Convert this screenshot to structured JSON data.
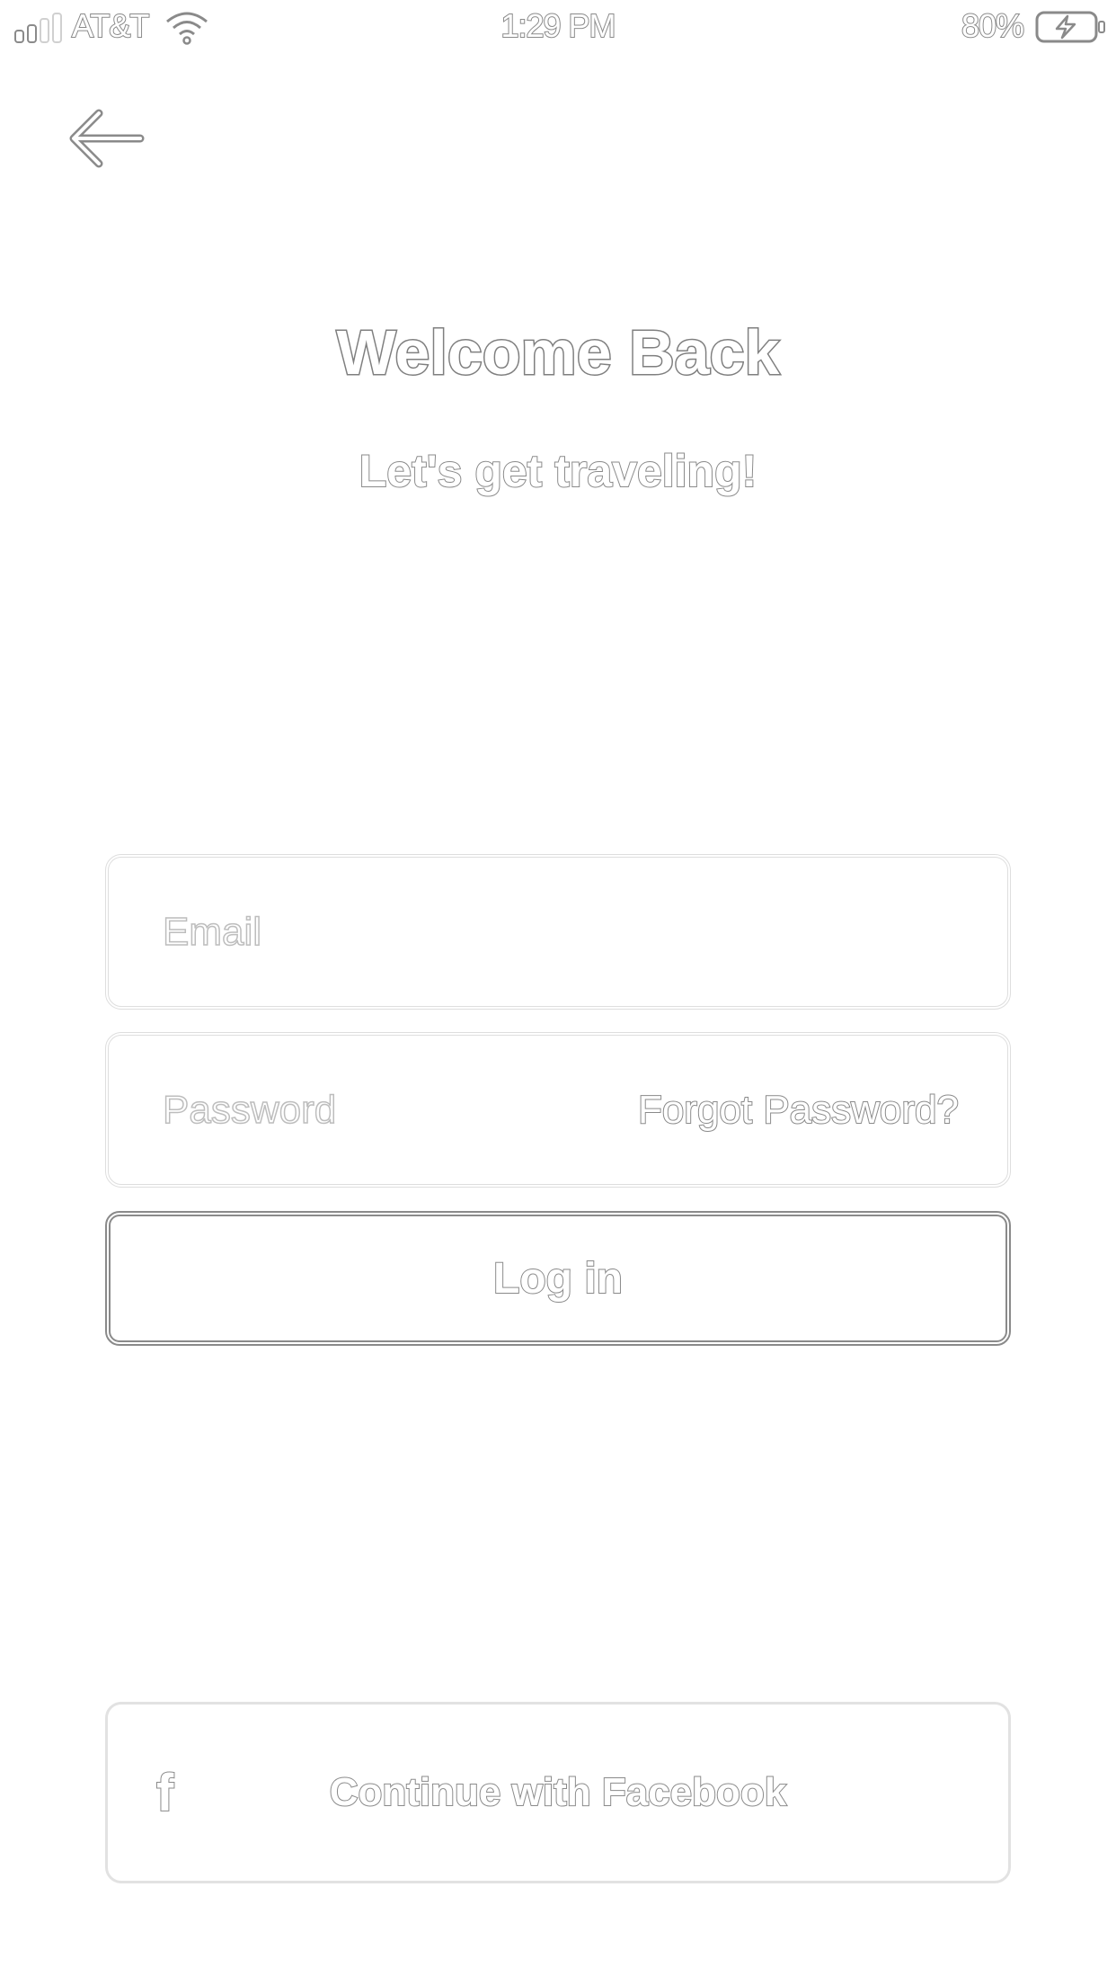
{
  "status_bar": {
    "carrier": "AT&T",
    "time": "1:29 PM",
    "battery_percent": "80%",
    "icons": [
      "signal-icon",
      "wifi-icon",
      "battery-charging-icon"
    ]
  },
  "header": {
    "back_icon": "back-arrow-icon"
  },
  "main": {
    "title": "Welcome Back",
    "subtitle": "Let's get traveling!"
  },
  "form": {
    "email": {
      "value": "",
      "placeholder": "Email"
    },
    "password": {
      "value": "",
      "placeholder": "Password"
    },
    "forgot_password_label": "Forgot Password?",
    "login_label": "Log in"
  },
  "social": {
    "facebook_icon_glyph": "f",
    "facebook_label": "Continue with Facebook"
  },
  "colors": {
    "text_outline": "#8a8a8a",
    "placeholder_outline": "#bdbdbd",
    "field_border": "#dedede",
    "background": "#ffffff"
  }
}
